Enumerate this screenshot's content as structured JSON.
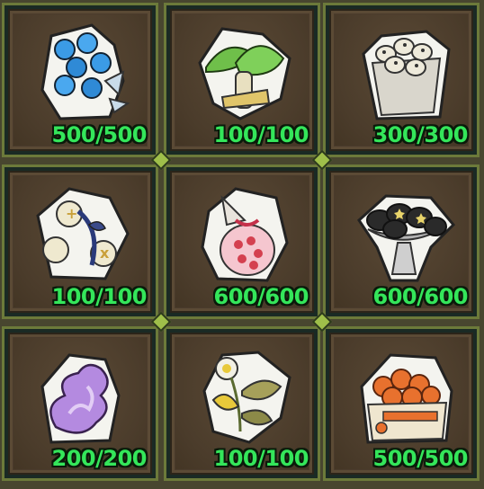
{
  "inventory": {
    "slots": [
      {
        "icon": "blue-berry-flower-icon",
        "count": "500/500"
      },
      {
        "icon": "green-mushroom-icon",
        "count": "100/100"
      },
      {
        "icon": "spotted-eggs-sack-icon",
        "count": "300/300"
      },
      {
        "icon": "clover-sprig-icon",
        "count": "100/100"
      },
      {
        "icon": "candy-gift-bag-icon",
        "count": "600/600"
      },
      {
        "icon": "dark-stones-bowl-icon",
        "count": "600/600"
      },
      {
        "icon": "purple-smoke-icon",
        "count": "200/200"
      },
      {
        "icon": "yellow-flower-icon",
        "count": "100/100"
      },
      {
        "icon": "orange-fruit-crate-icon",
        "count": "500/500"
      }
    ]
  },
  "colors": {
    "count_text": "#34e65a",
    "slot_bg": "#4a3b2c",
    "slot_border": "#6c7a3a"
  }
}
